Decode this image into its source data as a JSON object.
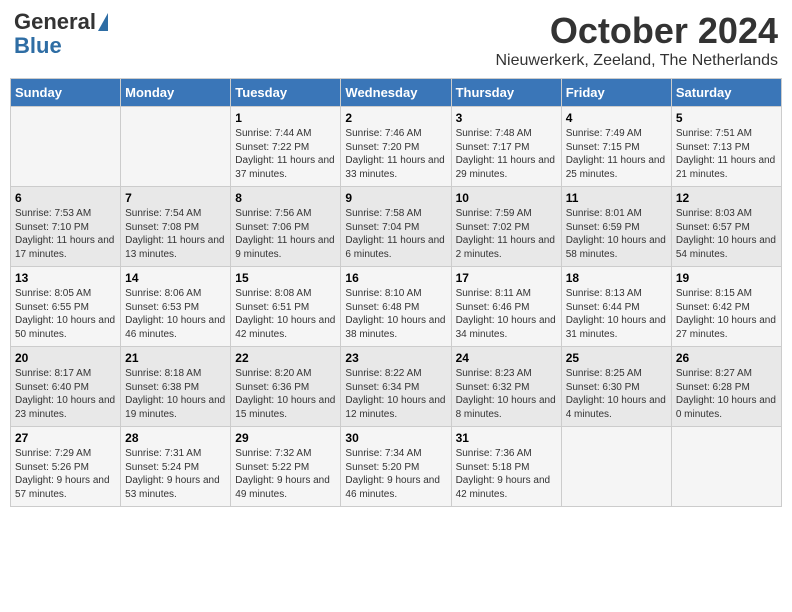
{
  "header": {
    "logo_general": "General",
    "logo_blue": "Blue",
    "month_title": "October 2024",
    "location": "Nieuwerkerk, Zeeland, The Netherlands"
  },
  "days_of_week": [
    "Sunday",
    "Monday",
    "Tuesday",
    "Wednesday",
    "Thursday",
    "Friday",
    "Saturday"
  ],
  "weeks": [
    [
      {
        "day": "",
        "info": ""
      },
      {
        "day": "",
        "info": ""
      },
      {
        "day": "1",
        "info": "Sunrise: 7:44 AM\nSunset: 7:22 PM\nDaylight: 11 hours and 37 minutes."
      },
      {
        "day": "2",
        "info": "Sunrise: 7:46 AM\nSunset: 7:20 PM\nDaylight: 11 hours and 33 minutes."
      },
      {
        "day": "3",
        "info": "Sunrise: 7:48 AM\nSunset: 7:17 PM\nDaylight: 11 hours and 29 minutes."
      },
      {
        "day": "4",
        "info": "Sunrise: 7:49 AM\nSunset: 7:15 PM\nDaylight: 11 hours and 25 minutes."
      },
      {
        "day": "5",
        "info": "Sunrise: 7:51 AM\nSunset: 7:13 PM\nDaylight: 11 hours and 21 minutes."
      }
    ],
    [
      {
        "day": "6",
        "info": "Sunrise: 7:53 AM\nSunset: 7:10 PM\nDaylight: 11 hours and 17 minutes."
      },
      {
        "day": "7",
        "info": "Sunrise: 7:54 AM\nSunset: 7:08 PM\nDaylight: 11 hours and 13 minutes."
      },
      {
        "day": "8",
        "info": "Sunrise: 7:56 AM\nSunset: 7:06 PM\nDaylight: 11 hours and 9 minutes."
      },
      {
        "day": "9",
        "info": "Sunrise: 7:58 AM\nSunset: 7:04 PM\nDaylight: 11 hours and 6 minutes."
      },
      {
        "day": "10",
        "info": "Sunrise: 7:59 AM\nSunset: 7:02 PM\nDaylight: 11 hours and 2 minutes."
      },
      {
        "day": "11",
        "info": "Sunrise: 8:01 AM\nSunset: 6:59 PM\nDaylight: 10 hours and 58 minutes."
      },
      {
        "day": "12",
        "info": "Sunrise: 8:03 AM\nSunset: 6:57 PM\nDaylight: 10 hours and 54 minutes."
      }
    ],
    [
      {
        "day": "13",
        "info": "Sunrise: 8:05 AM\nSunset: 6:55 PM\nDaylight: 10 hours and 50 minutes."
      },
      {
        "day": "14",
        "info": "Sunrise: 8:06 AM\nSunset: 6:53 PM\nDaylight: 10 hours and 46 minutes."
      },
      {
        "day": "15",
        "info": "Sunrise: 8:08 AM\nSunset: 6:51 PM\nDaylight: 10 hours and 42 minutes."
      },
      {
        "day": "16",
        "info": "Sunrise: 8:10 AM\nSunset: 6:48 PM\nDaylight: 10 hours and 38 minutes."
      },
      {
        "day": "17",
        "info": "Sunrise: 8:11 AM\nSunset: 6:46 PM\nDaylight: 10 hours and 34 minutes."
      },
      {
        "day": "18",
        "info": "Sunrise: 8:13 AM\nSunset: 6:44 PM\nDaylight: 10 hours and 31 minutes."
      },
      {
        "day": "19",
        "info": "Sunrise: 8:15 AM\nSunset: 6:42 PM\nDaylight: 10 hours and 27 minutes."
      }
    ],
    [
      {
        "day": "20",
        "info": "Sunrise: 8:17 AM\nSunset: 6:40 PM\nDaylight: 10 hours and 23 minutes."
      },
      {
        "day": "21",
        "info": "Sunrise: 8:18 AM\nSunset: 6:38 PM\nDaylight: 10 hours and 19 minutes."
      },
      {
        "day": "22",
        "info": "Sunrise: 8:20 AM\nSunset: 6:36 PM\nDaylight: 10 hours and 15 minutes."
      },
      {
        "day": "23",
        "info": "Sunrise: 8:22 AM\nSunset: 6:34 PM\nDaylight: 10 hours and 12 minutes."
      },
      {
        "day": "24",
        "info": "Sunrise: 8:23 AM\nSunset: 6:32 PM\nDaylight: 10 hours and 8 minutes."
      },
      {
        "day": "25",
        "info": "Sunrise: 8:25 AM\nSunset: 6:30 PM\nDaylight: 10 hours and 4 minutes."
      },
      {
        "day": "26",
        "info": "Sunrise: 8:27 AM\nSunset: 6:28 PM\nDaylight: 10 hours and 0 minutes."
      }
    ],
    [
      {
        "day": "27",
        "info": "Sunrise: 7:29 AM\nSunset: 5:26 PM\nDaylight: 9 hours and 57 minutes."
      },
      {
        "day": "28",
        "info": "Sunrise: 7:31 AM\nSunset: 5:24 PM\nDaylight: 9 hours and 53 minutes."
      },
      {
        "day": "29",
        "info": "Sunrise: 7:32 AM\nSunset: 5:22 PM\nDaylight: 9 hours and 49 minutes."
      },
      {
        "day": "30",
        "info": "Sunrise: 7:34 AM\nSunset: 5:20 PM\nDaylight: 9 hours and 46 minutes."
      },
      {
        "day": "31",
        "info": "Sunrise: 7:36 AM\nSunset: 5:18 PM\nDaylight: 9 hours and 42 minutes."
      },
      {
        "day": "",
        "info": ""
      },
      {
        "day": "",
        "info": ""
      }
    ]
  ]
}
